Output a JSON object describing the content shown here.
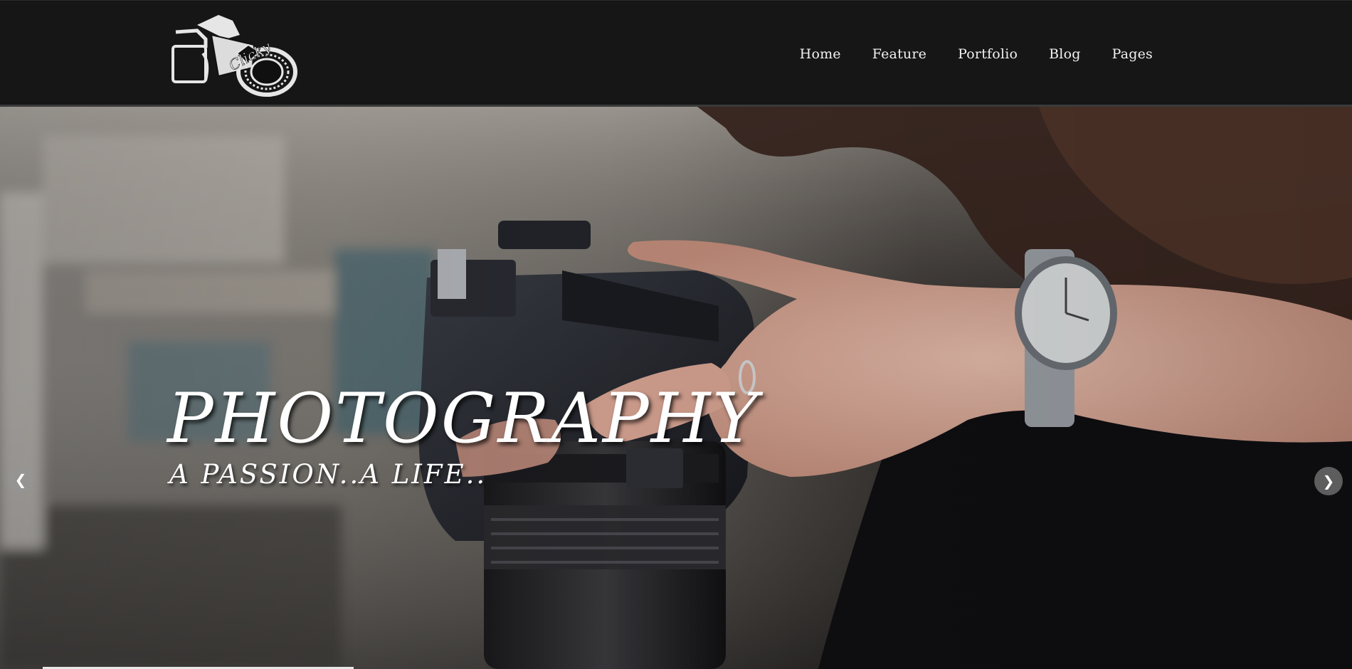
{
  "logo": {
    "text": "Clicky"
  },
  "nav": {
    "items": [
      {
        "label": "Home"
      },
      {
        "label": "Feature"
      },
      {
        "label": "Portfolio"
      },
      {
        "label": "Blog"
      },
      {
        "label": "Pages"
      }
    ]
  },
  "hero": {
    "title": "PHOTOGRAPHY",
    "subtitle": "A PASSION..A LIFE..",
    "prev_icon": "chevron-left-icon",
    "next_icon": "chevron-right-icon",
    "progress": 0.23
  },
  "colors": {
    "navbar_bg": "#161616",
    "nav_text": "#f2f2f2",
    "hero_text": "#ffffff",
    "arrow_bg": "#787878"
  }
}
